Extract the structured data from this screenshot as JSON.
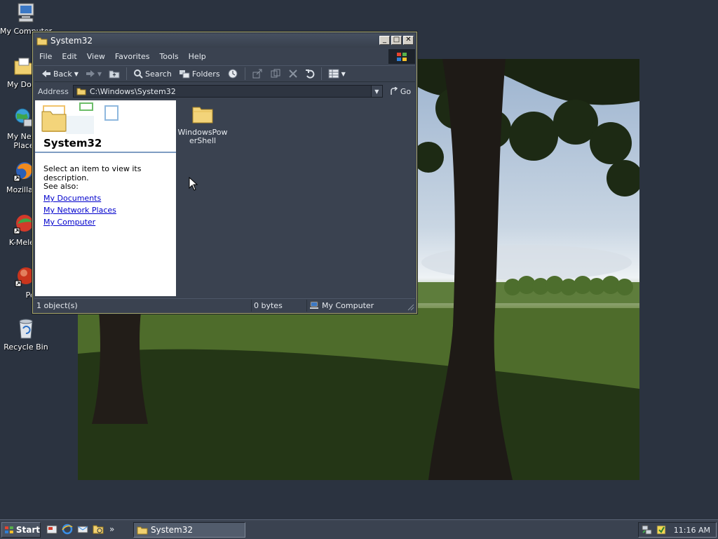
{
  "desktop": {
    "icons": [
      {
        "label": "My Computer",
        "icon": "my-computer-icon"
      },
      {
        "label": "My Docu",
        "icon": "my-documents-icon"
      },
      {
        "label": "My Netw",
        "label2": "Place",
        "icon": "network-places-icon"
      },
      {
        "label": "Mozilla Fi",
        "icon": "firefox-icon"
      },
      {
        "label": "K-Melec",
        "icon": "k-meleon-icon"
      },
      {
        "label": "Pega",
        "icon": "pegasus-icon"
      },
      {
        "label": "Recycle Bin",
        "icon": "recycle-bin-icon"
      }
    ]
  },
  "window": {
    "title": "System32",
    "menu": [
      "File",
      "Edit",
      "View",
      "Favorites",
      "Tools",
      "Help"
    ],
    "toolbar": {
      "back": "Back",
      "search": "Search",
      "folders": "Folders"
    },
    "address": {
      "label": "Address",
      "value": "C:\\Windows\\System32",
      "go": "Go"
    },
    "left_pane": {
      "title": "System32",
      "description": "Select an item to view its description.",
      "see_also": "See also:",
      "links": [
        "My Documents",
        "My Network Places",
        "My Computer"
      ]
    },
    "files": [
      {
        "name": "WindowsPowerShell",
        "icon": "folder-icon"
      }
    ],
    "status": {
      "objects": "1 object(s)",
      "size": "0 bytes",
      "zone": "My Computer"
    }
  },
  "taskbar": {
    "start": "Start",
    "task_title": "System32",
    "clock": "11:16 AM"
  },
  "colors": {
    "desktop": "#2b3340",
    "window_bg": "#3a4250",
    "link": "#0000cc",
    "window_border": "#a8a66a"
  }
}
